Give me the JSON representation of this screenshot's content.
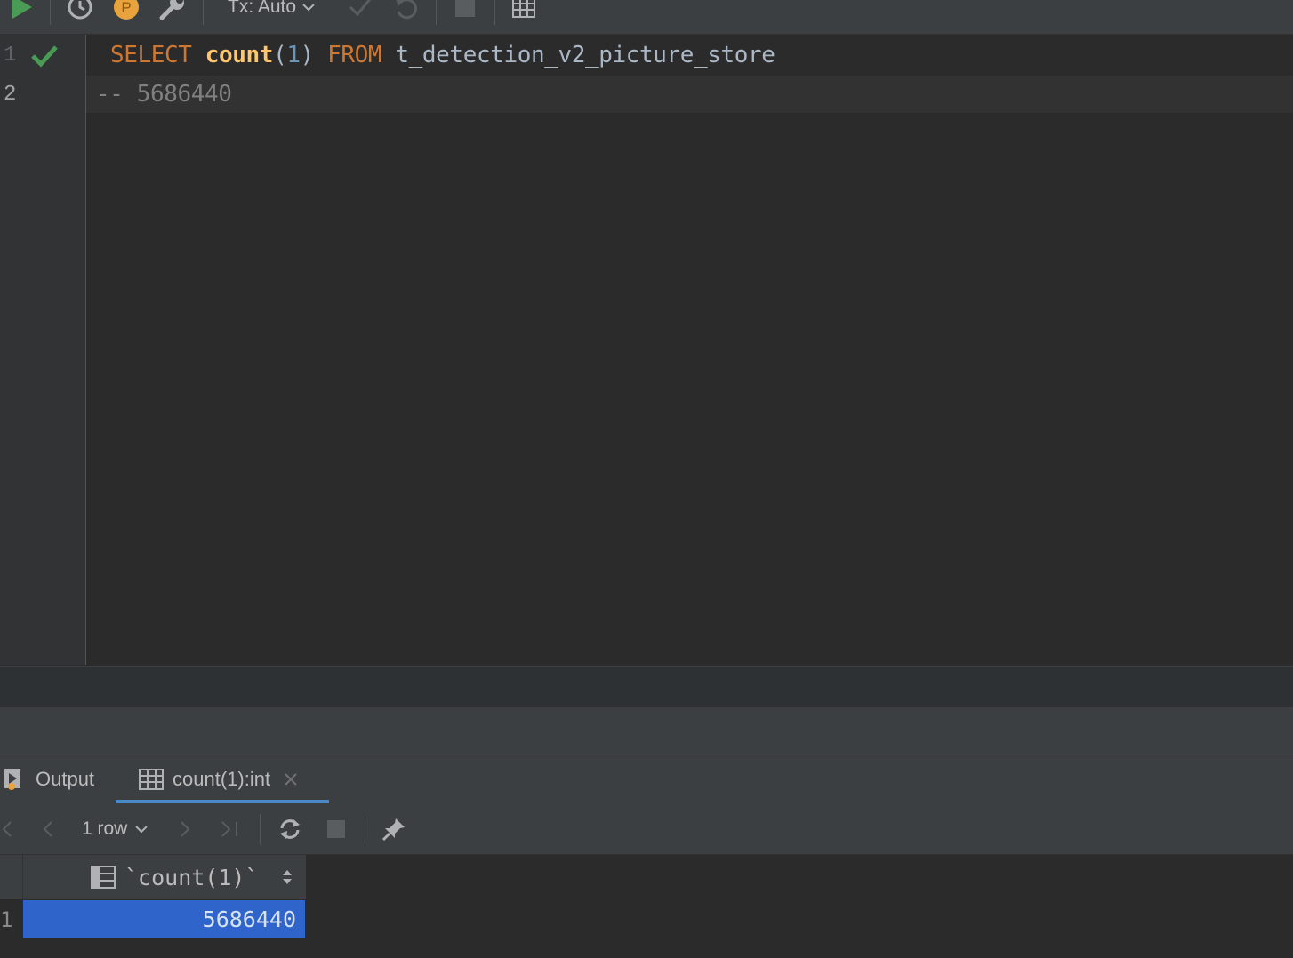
{
  "toolbar": {
    "tx_label": "Tx: Auto"
  },
  "editor": {
    "line_numbers": [
      "1",
      "2"
    ],
    "line1": {
      "select": "SELECT",
      "func": "count",
      "open_paren": "(",
      "arg": "1",
      "close_paren": ")",
      "from": "FROM",
      "table": "t_detection_v2_picture_store"
    },
    "line2": "-- 5686440"
  },
  "tabs": {
    "output": "Output",
    "result": "count(1):int"
  },
  "results_toolbar": {
    "rows_label": "1 row"
  },
  "grid": {
    "column_header": "`count(1)`",
    "row_number": "1",
    "rows": [
      [
        "5686440"
      ]
    ]
  },
  "colors": {
    "keyword": "#cc7832",
    "function": "#ffc66d",
    "number": "#6897bb",
    "comment": "#808080",
    "selection": "#2f65ca",
    "run_green": "#499c54",
    "tab_underline": "#4a88c7"
  }
}
